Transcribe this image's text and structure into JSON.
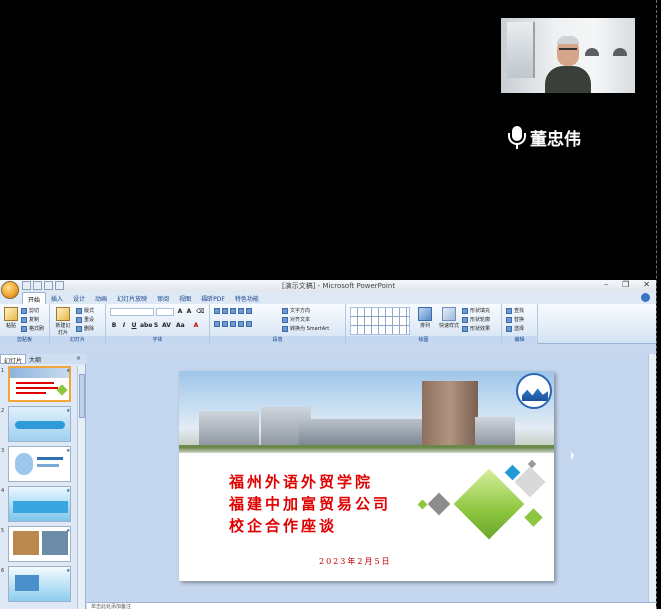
{
  "meeting": {
    "speaker_name": "董忠伟"
  },
  "window": {
    "title": "[演示文稿] - Microsoft PowerPoint"
  },
  "ribbon": {
    "tabs": [
      "开始",
      "插入",
      "设计",
      "动画",
      "幻灯片放映",
      "审阅",
      "视图",
      "福昕PDF",
      "特色功能"
    ],
    "active_tab": "开始",
    "clipboard": {
      "paste": "粘贴",
      "cut": "剪切",
      "copy": "复制",
      "format_painter": "格式刷",
      "label": "剪贴板"
    },
    "slides": {
      "new_slide": "新建幻灯片",
      "layout": "版式",
      "reset": "重设",
      "delete": "删除",
      "label": "幻灯片"
    },
    "font": {
      "label": "字体"
    },
    "paragraph": {
      "text_direction": "文字方向",
      "align_text": "对齐文本",
      "smartart": "转换为 SmartArt",
      "label": "段落"
    },
    "drawing": {
      "arrange": "排列",
      "quick_styles": "快速样式",
      "shape_fill": "形状填充",
      "shape_outline": "形状轮廓",
      "shape_effects": "形状效果",
      "label": "绘图"
    },
    "editing": {
      "find": "查找",
      "replace": "替换",
      "select": "选择",
      "label": "编辑"
    }
  },
  "left_pane": {
    "tab_slides": "幻灯片",
    "tab_outline": "大纲",
    "close": "×",
    "slide_numbers": [
      "1",
      "2",
      "3",
      "4",
      "5",
      "6"
    ]
  },
  "slide": {
    "title_lines": [
      "福州外语外贸学院",
      "福建中加富贸易公司",
      "校企合作座谈"
    ],
    "date": "2023年2月5日"
  },
  "notes": {
    "placeholder": "单击此处添加备注"
  },
  "colors": {
    "title_red": "#e00000",
    "diamond_green": "#8dc63f",
    "diamond_blue": "#1e9ad6",
    "diamond_gray": "#8c8c8c"
  }
}
